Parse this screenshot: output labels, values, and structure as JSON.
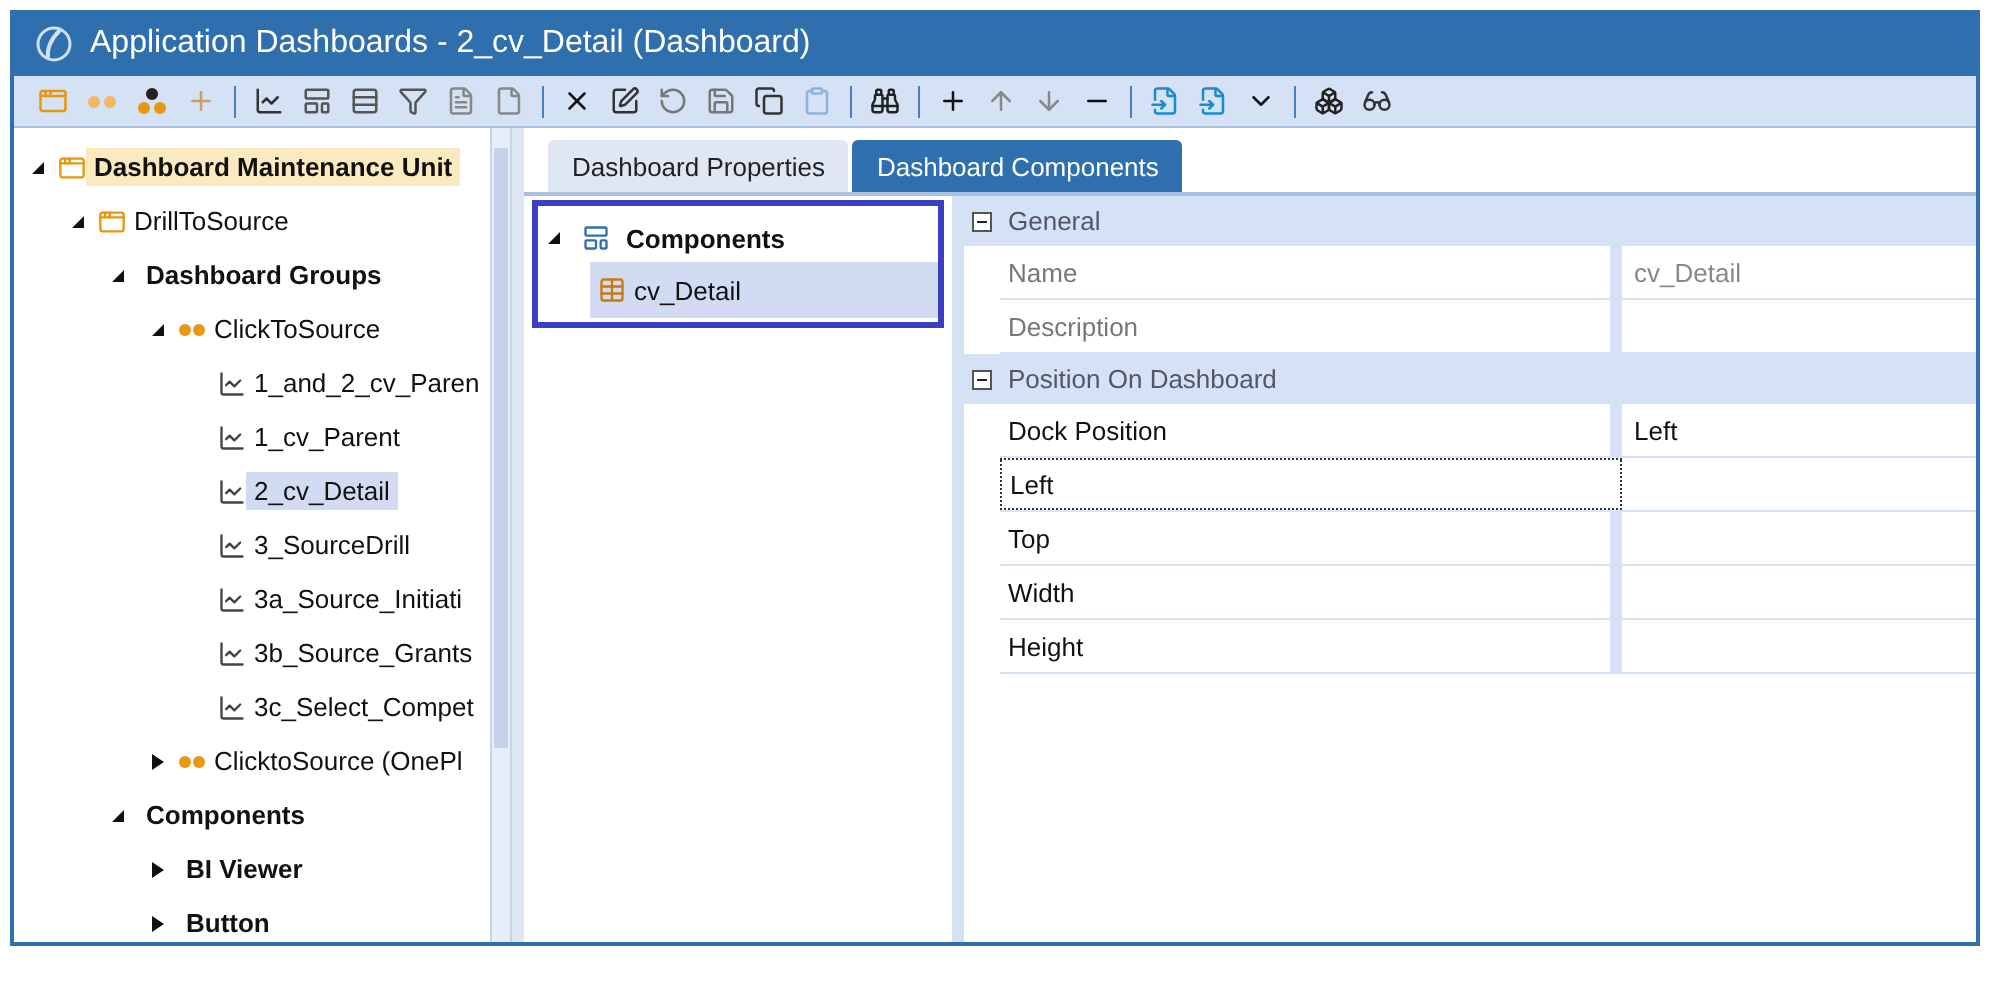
{
  "window": {
    "title": "Application Dashboards - 2_cv_Detail (Dashboard)"
  },
  "tree": [
    {
      "label": "Dashboard Maintenance Unit",
      "kind": "unit",
      "expanded": true,
      "selected": false,
      "children": [
        {
          "label": "DrillToSource",
          "kind": "unit",
          "expanded": true,
          "selected": false,
          "children": [
            {
              "label": "Dashboard Groups",
              "kind": "folder",
              "expanded": true,
              "selected": false,
              "children": [
                {
                  "label": "ClickToSource",
                  "kind": "group",
                  "expanded": true,
                  "selected": false,
                  "children": [
                    {
                      "label": "1_and_2_cv_Paren",
                      "kind": "dashboard",
                      "selected": false
                    },
                    {
                      "label": "1_cv_Parent",
                      "kind": "dashboard",
                      "selected": false
                    },
                    {
                      "label": "2_cv_Detail",
                      "kind": "dashboard",
                      "selected": true
                    },
                    {
                      "label": "3_SourceDrill",
                      "kind": "dashboard",
                      "selected": false
                    },
                    {
                      "label": "3a_Source_Initiati",
                      "kind": "dashboard",
                      "selected": false
                    },
                    {
                      "label": "3b_Source_Grants",
                      "kind": "dashboard",
                      "selected": false
                    },
                    {
                      "label": "3c_Select_Compet",
                      "kind": "dashboard",
                      "selected": false
                    }
                  ]
                },
                {
                  "label": "ClicktoSource (OnePl",
                  "kind": "group",
                  "expanded": false,
                  "selected": false
                }
              ]
            },
            {
              "label": "Components",
              "kind": "folder",
              "expanded": true,
              "selected": false,
              "children": [
                {
                  "label": "BI Viewer",
                  "kind": "folder",
                  "expanded": false,
                  "selected": false
                },
                {
                  "label": "Button",
                  "kind": "folder",
                  "expanded": false,
                  "selected": false
                }
              ]
            }
          ]
        }
      ]
    }
  ],
  "tabs": [
    {
      "label": "Dashboard Properties",
      "selected": false
    },
    {
      "label": "Dashboard Components",
      "selected": true
    }
  ],
  "components": {
    "label": "Components",
    "expanded": true,
    "children": [
      {
        "label": "cv_Detail",
        "selected": true
      }
    ]
  },
  "properties": [
    {
      "category": "General",
      "expanded": true,
      "rows": [
        {
          "name": "Name",
          "value": "cv_Detail",
          "disabled": true,
          "focused": false
        },
        {
          "name": "Description",
          "disabled": true,
          "focused": false
        }
      ]
    },
    {
      "category": "Position On Dashboard",
      "expanded": true,
      "rows": [
        {
          "name": "Dock Position",
          "value": "Left",
          "disabled": false,
          "focused": false
        },
        {
          "name": "Left",
          "disabled": false,
          "focused": true
        },
        {
          "name": "Top",
          "disabled": false,
          "focused": false
        },
        {
          "name": "Width",
          "disabled": false,
          "focused": false
        },
        {
          "name": "Height",
          "disabled": false,
          "focused": false
        }
      ]
    }
  ]
}
